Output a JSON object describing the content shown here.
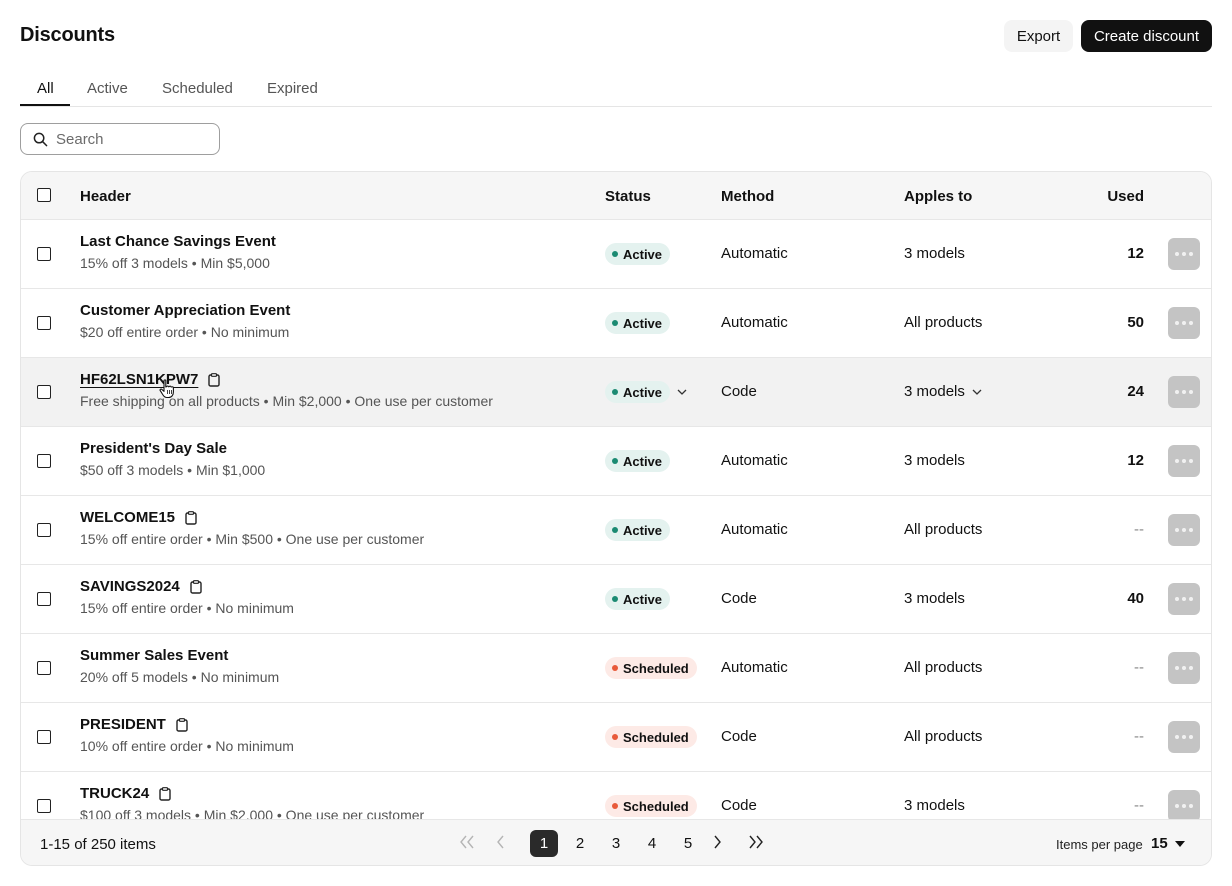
{
  "header": {
    "title": "Discounts",
    "export_label": "Export",
    "create_label": "Create discount"
  },
  "tabs": [
    {
      "label": "All",
      "active": true
    },
    {
      "label": "Active",
      "active": false
    },
    {
      "label": "Scheduled",
      "active": false
    },
    {
      "label": "Expired",
      "active": false
    }
  ],
  "search": {
    "placeholder": "Search",
    "value": ""
  },
  "table": {
    "columns": {
      "header": "Header",
      "status": "Status",
      "method": "Method",
      "applies": "Apples to",
      "used": "Used"
    },
    "rows": [
      {
        "title": "Last Chance Savings Event",
        "subtitle": "15% off 3 models • Min $5,000",
        "status": "Active",
        "method": "Automatic",
        "applies": "3 models",
        "used": "12"
      },
      {
        "title": "Customer Appreciation Event",
        "subtitle": "$20 off entire order • No minimum",
        "status": "Active",
        "method": "Automatic",
        "applies": "All products",
        "used": "50"
      },
      {
        "title": "HF62LSN1KPW7",
        "subtitle": "Free shipping on all products • Min $2,000 • One use per customer",
        "status": "Active",
        "method": "Code",
        "applies": "3 models",
        "used": "24"
      },
      {
        "title": "President's Day Sale",
        "subtitle": "$50 off 3 models • Min $1,000",
        "status": "Active",
        "method": "Automatic",
        "applies": "3 models",
        "used": "12"
      },
      {
        "title": "WELCOME15",
        "subtitle": "15% off entire order • Min $500 • One use per customer",
        "status": "Active",
        "method": "Automatic",
        "applies": "All products",
        "used": "--"
      },
      {
        "title": "SAVINGS2024",
        "subtitle": "15% off entire order • No minimum",
        "status": "Active",
        "method": "Code",
        "applies": "3 models",
        "used": "40"
      },
      {
        "title": "Summer Sales Event",
        "subtitle": "20% off 5 models • No minimum",
        "status": "Scheduled",
        "method": "Automatic",
        "applies": "All products",
        "used": "--"
      },
      {
        "title": "PRESIDENT",
        "subtitle": "10% off entire order • No minimum",
        "status": "Scheduled",
        "method": "Code",
        "applies": "All products",
        "used": "--"
      },
      {
        "title": "TRUCK24",
        "subtitle": "$100 off 3 models • Min $2,000 • One use per customer",
        "status": "Scheduled",
        "method": "Code",
        "applies": "3 models",
        "used": "--"
      }
    ]
  },
  "pagination": {
    "range_text": "1-15 of 250 items",
    "pages": [
      "1",
      "2",
      "3",
      "4",
      "5"
    ],
    "current_page": "1",
    "items_per_page_label": "Items per page",
    "items_per_page_value": "15"
  },
  "colors": {
    "primary": "#111111",
    "active_badge_bg": "#e4f2ef",
    "active_dot": "#1b8a72",
    "scheduled_badge_bg": "#fdeae6",
    "scheduled_dot": "#e85a3a"
  },
  "icons": {
    "search": "search-icon",
    "copy": "clipboard-icon",
    "more": "more-horizontal-icon",
    "first": "chevrons-left-icon",
    "prev": "chevron-left-icon",
    "next": "chevron-right-icon",
    "last": "chevrons-right-icon",
    "dropdown": "caret-down-icon"
  }
}
